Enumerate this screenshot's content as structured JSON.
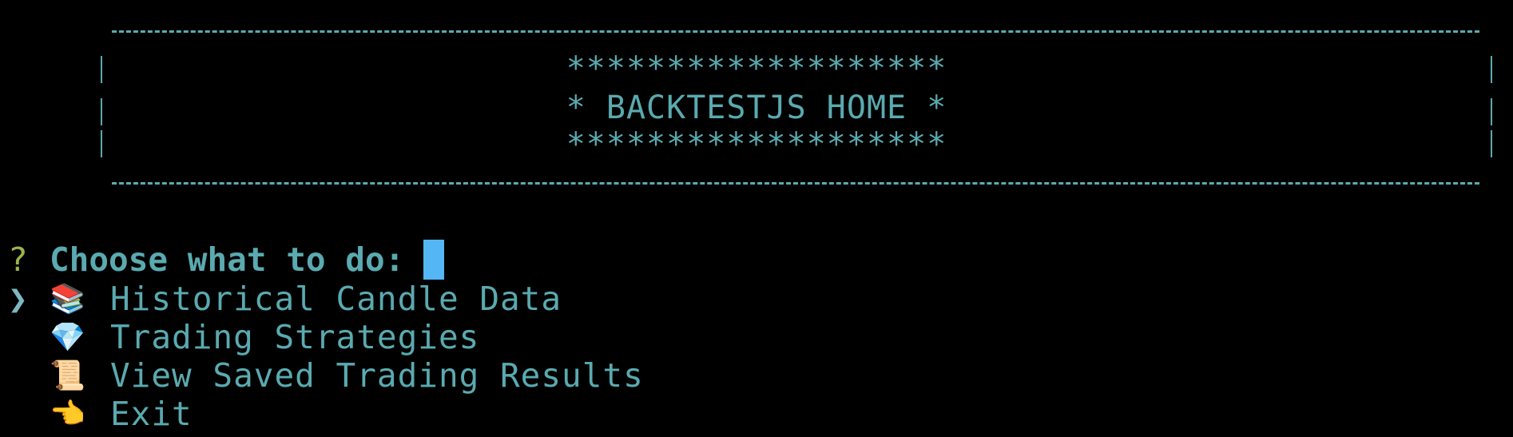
{
  "banner": {
    "line1": "*******************",
    "title": "* BACKTESTJS HOME *",
    "line3": "*******************"
  },
  "prompt": {
    "mark": "?",
    "text": "Choose what to do:"
  },
  "menu": {
    "pointer": "❯",
    "items": [
      {
        "icon": "📚",
        "icon_name": "books-icon",
        "label": "Historical Candle Data",
        "selected": true
      },
      {
        "icon": "💎",
        "icon_name": "gem-icon",
        "label": "Trading Strategies",
        "selected": false
      },
      {
        "icon": "📜",
        "icon_name": "scroll-icon",
        "label": "View Saved Trading Results",
        "selected": false
      },
      {
        "icon": "👈",
        "icon_name": "pointing-hand-icon",
        "label": "Exit",
        "selected": false
      }
    ]
  },
  "colors": {
    "text": "#5aaab0",
    "question_mark": "#9ab44c",
    "cursor": "#55b6f5",
    "background": "#000000"
  }
}
